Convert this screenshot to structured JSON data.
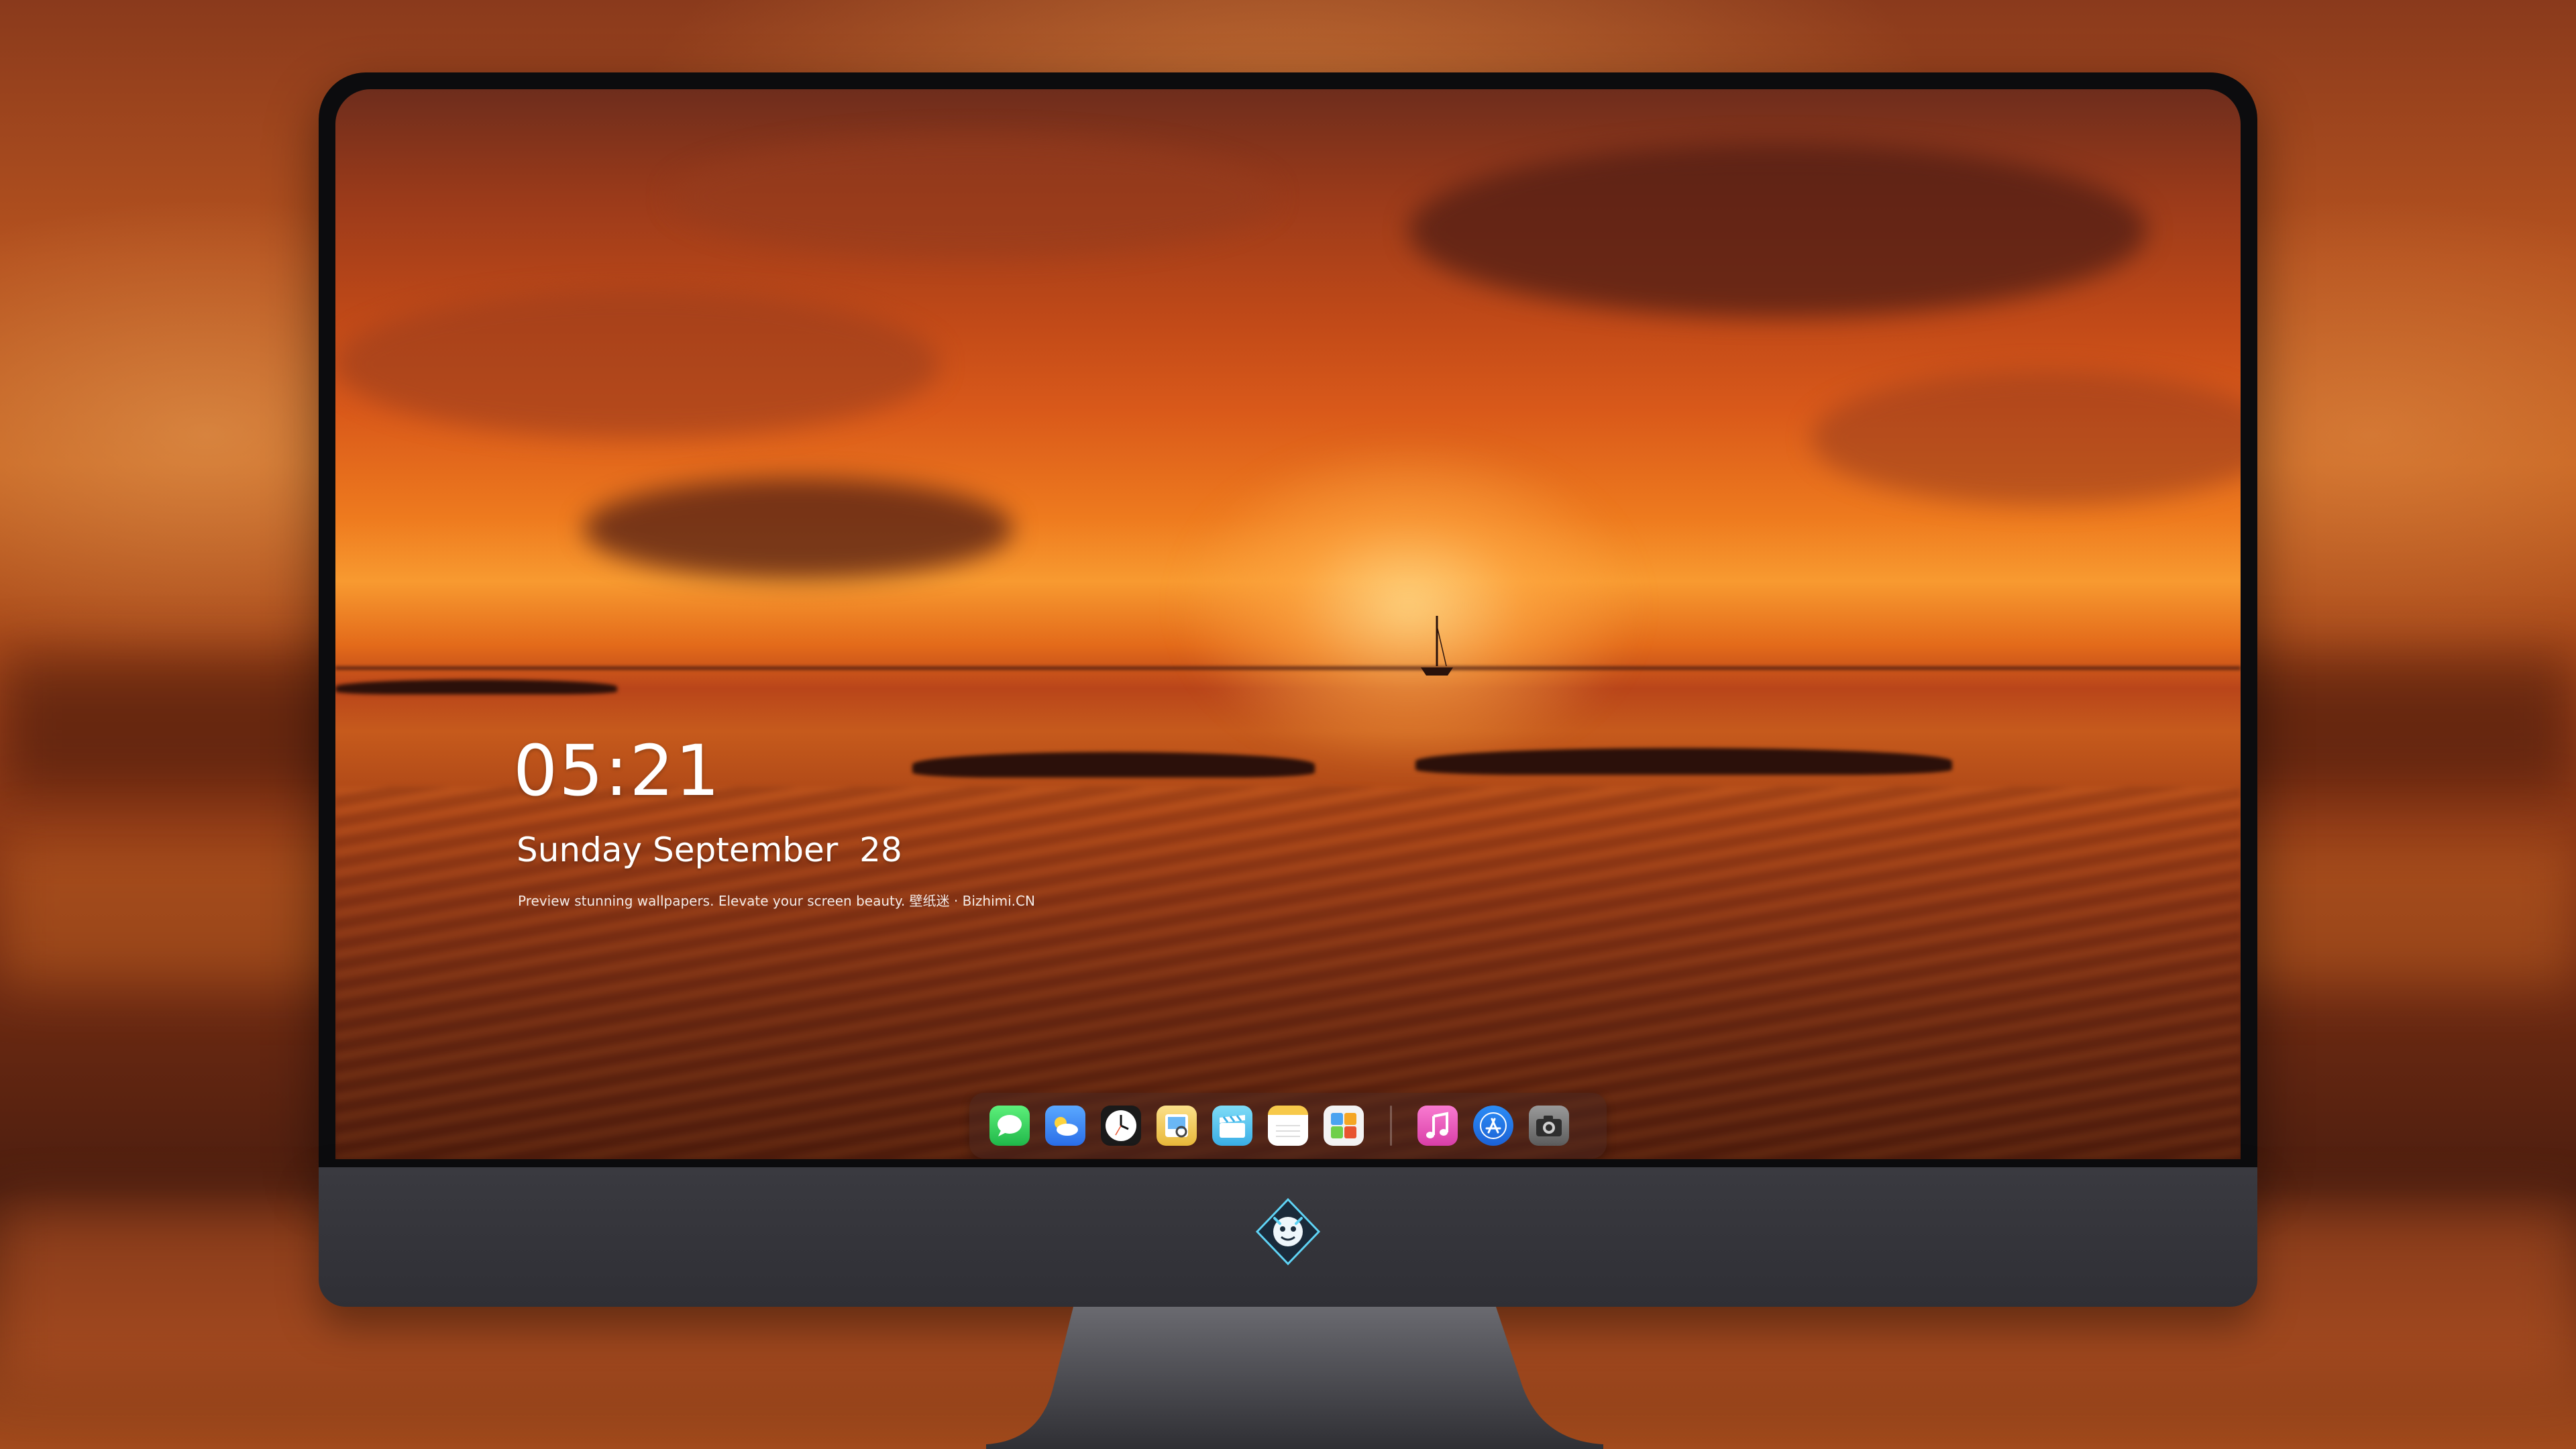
{
  "lock_screen": {
    "time": "05:21",
    "date": "Sunday September  28",
    "tagline": "Preview stunning wallpapers. Elevate your screen beauty. 壁纸迷 · Bizhimi.CN"
  },
  "dock": {
    "apps": [
      {
        "name": "messages-icon",
        "color": "#33d158"
      },
      {
        "name": "weather-icon",
        "color": "#3a8ef5"
      },
      {
        "name": "clock-icon",
        "color": "#111111"
      },
      {
        "name": "preview-icon",
        "color": "#f0c248"
      },
      {
        "name": "claquette-icon",
        "color": "#4fc3f0"
      },
      {
        "name": "notes-icon",
        "color": "#f7d24a"
      },
      {
        "name": "photos-icon",
        "color": "#f3f3f3"
      },
      {
        "name": "music-icon",
        "color": "#f24fb5"
      },
      {
        "name": "app-store-icon",
        "color": "#2b8cf5"
      },
      {
        "name": "camera-icon",
        "color": "#6b6b6b"
      }
    ]
  },
  "brand": {
    "logo": "dragon-mascot-logo"
  }
}
